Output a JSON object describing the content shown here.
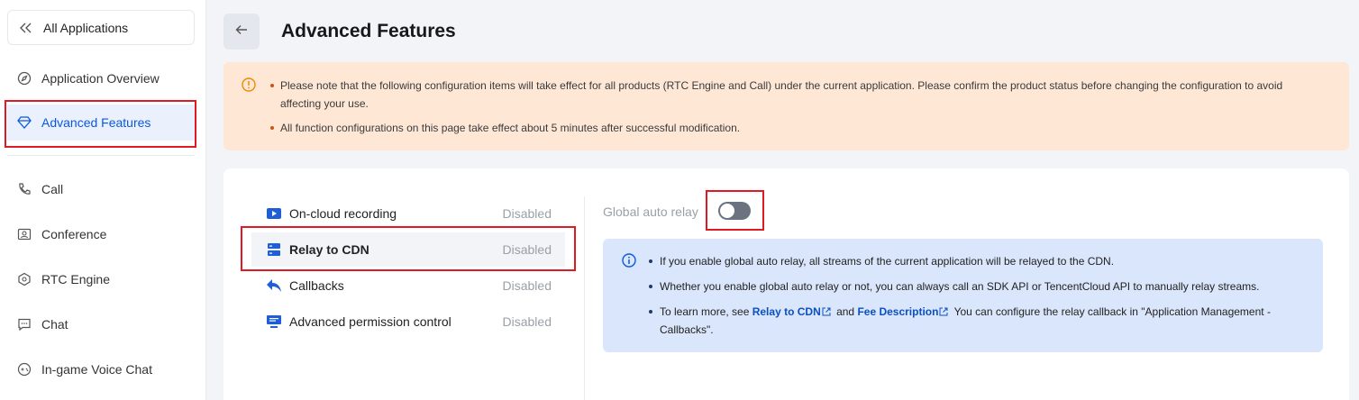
{
  "sidebar": {
    "all_apps": "All Applications",
    "items": [
      {
        "label": "Application Overview",
        "icon": "compass-icon"
      },
      {
        "label": "Advanced Features",
        "icon": "diamond-icon",
        "active": true
      },
      {
        "label": "Call",
        "icon": "phone-icon"
      },
      {
        "label": "Conference",
        "icon": "conference-icon"
      },
      {
        "label": "RTC Engine",
        "icon": "engine-icon"
      },
      {
        "label": "Chat",
        "icon": "chat-icon"
      },
      {
        "label": "In-game Voice Chat",
        "icon": "gamepad-icon"
      }
    ]
  },
  "header": {
    "title": "Advanced Features"
  },
  "notice": {
    "items": [
      "Please note that the following configuration items will take effect for all products (RTC Engine and Call) under the current application. Please confirm the product status before changing the configuration to avoid affecting your use.",
      "All function configurations on this page take effect about 5 minutes after successful modification."
    ]
  },
  "features": [
    {
      "label": "On-cloud recording",
      "status": "Disabled",
      "icon": "video-icon"
    },
    {
      "label": "Relay to CDN",
      "status": "Disabled",
      "icon": "server-icon",
      "selected": true
    },
    {
      "label": "Callbacks",
      "status": "Disabled",
      "icon": "reply-arrow-icon"
    },
    {
      "label": "Advanced permission control",
      "status": "Disabled",
      "icon": "monitor-icon"
    }
  ],
  "relay": {
    "label": "Global auto relay",
    "enabled": false
  },
  "info": {
    "line1": "If you enable global auto relay, all streams of the current application will be relayed to the CDN.",
    "line2": "Whether you enable global auto relay or not, you can always call an SDK API or TencentCloud API to manually relay streams.",
    "line3_a": "To learn more, see ",
    "link1": "Relay to CDN",
    "line3_b": " and ",
    "link2": "Fee Description",
    "line3_c": " You can configure the relay callback in \"Application Management - Callbacks\"."
  },
  "colors": {
    "accent": "#0a58e0",
    "highlight_box": "#e01a22",
    "notice_bg": "#ffe7d6",
    "info_bg": "#d9e6fb"
  }
}
